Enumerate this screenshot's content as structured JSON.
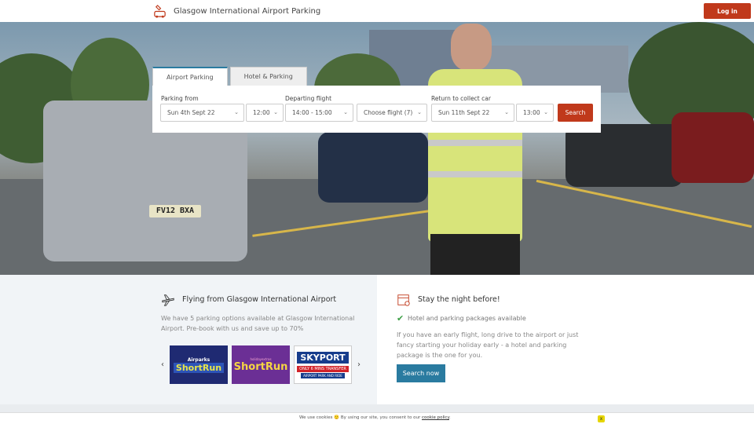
{
  "header": {
    "site_title": "Glasgow International Airport Parking",
    "logo_icon": "parking-logo-icon",
    "login_label": "Log in"
  },
  "hero": {
    "plate_text": "FV12 BXA"
  },
  "search": {
    "tabs": [
      {
        "label": "Airport Parking",
        "active": true
      },
      {
        "label": "Hotel & Parking",
        "active": false
      }
    ],
    "parking_from_label": "Parking from",
    "parking_from_date": "Sun 4th Sept 22",
    "parking_from_time": "12:00",
    "departing_flight_label": "Departing flight",
    "departing_flight_window": "14:00 - 15:00",
    "choose_flight": "Choose flight (7)",
    "return_label": "Return to collect car",
    "return_date": "Sun 11th Sept 22",
    "return_time": "13:00",
    "search_label": "Search"
  },
  "flying": {
    "icon": "airplane-icon",
    "heading": "Flying from Glasgow International Airport",
    "text": "We have 5 parking options available at Glasgow International Airport. Pre-book with us and save up to 70%",
    "prev": "‹",
    "next": "›",
    "partners": [
      {
        "line1": "Airparks",
        "line2": "ShortRun"
      },
      {
        "line1": "holidayextras",
        "line2": "ShortRun"
      },
      {
        "line1": "SKYPORT",
        "line2": "ONLY 6 MINS TRANSFER",
        "line3": "AIRPORT PARK AND RIDE"
      }
    ]
  },
  "stay": {
    "icon": "hotel-calendar-icon",
    "heading": "Stay the night before!",
    "check_text": "Hotel and parking packages available",
    "text": "If you have an early flight, long drive to the airport or just fancy starting your holiday early - a hotel and parking package is the one for you.",
    "button": "Search now"
  },
  "cookie": {
    "prefix": "We use cookies",
    "middle": "By using our site, you consent to our",
    "link": "cookie policy",
    "suffix": ".",
    "close": "x"
  },
  "colors": {
    "accent_red": "#c0391b",
    "accent_blue": "#2a7ba0",
    "check_green": "#3d9f46"
  }
}
